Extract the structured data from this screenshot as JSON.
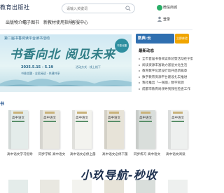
{
  "header": {
    "logo": "教育出版社",
    "search_placeholder": "请输入关键词",
    "wechat_label": "微信商城",
    "login_label": "登录"
  },
  "nav": {
    "items": [
      "出版物介绍",
      "电子图书",
      "新教材使用指导",
      "客服中心"
    ]
  },
  "banner": {
    "caption": "第二届书香阅读平台读书活动",
    "title": "书香向北 阅见未来",
    "date": "2025.5.15 - 5.19",
    "sub": "书香北疆 · 全民阅读 · 共建共享",
    "sub2": "活动方式 · 线上线下",
    "seal": "书香北疆"
  },
  "promo": {
    "label": "数典·云",
    "badge": "立即体验"
  },
  "news": {
    "heading": "最新动态",
    "items": [
      "全市首届书香阅读体验暨活动在宁夏启动",
      "阅读资源丰富助力基层文化生活",
      "教育数字化建设行动开启新篇章",
      "数字教育资源平台建设扎实推进",
      "我社推出「一张图」数字资源",
      "成都市教育局领导到我社检查工作"
    ]
  },
  "section": {
    "label": "书"
  },
  "books": [
    {
      "cover_text": "高中语文",
      "title": "高中语文学习指导",
      "color": "#e4ecea"
    },
    {
      "cover_text": "高中语文",
      "title": "同步学练 高中语文",
      "color": "#e9e8e1"
    },
    {
      "cover_text": "高中语文",
      "title": "高中语文必修上册",
      "color": "#f3f3ef"
    },
    {
      "cover_text": "高中语文",
      "title": "高中语文必修下册",
      "color": "#e7e3d8"
    },
    {
      "cover_text": "高中语文",
      "title": "同步练习 高中语文",
      "color": "#d9dedb"
    },
    {
      "cover_text": "高中语文",
      "title": "高中语文阅读",
      "color": "#eef0ef"
    }
  ],
  "watermark": "小玖导航-秒收"
}
